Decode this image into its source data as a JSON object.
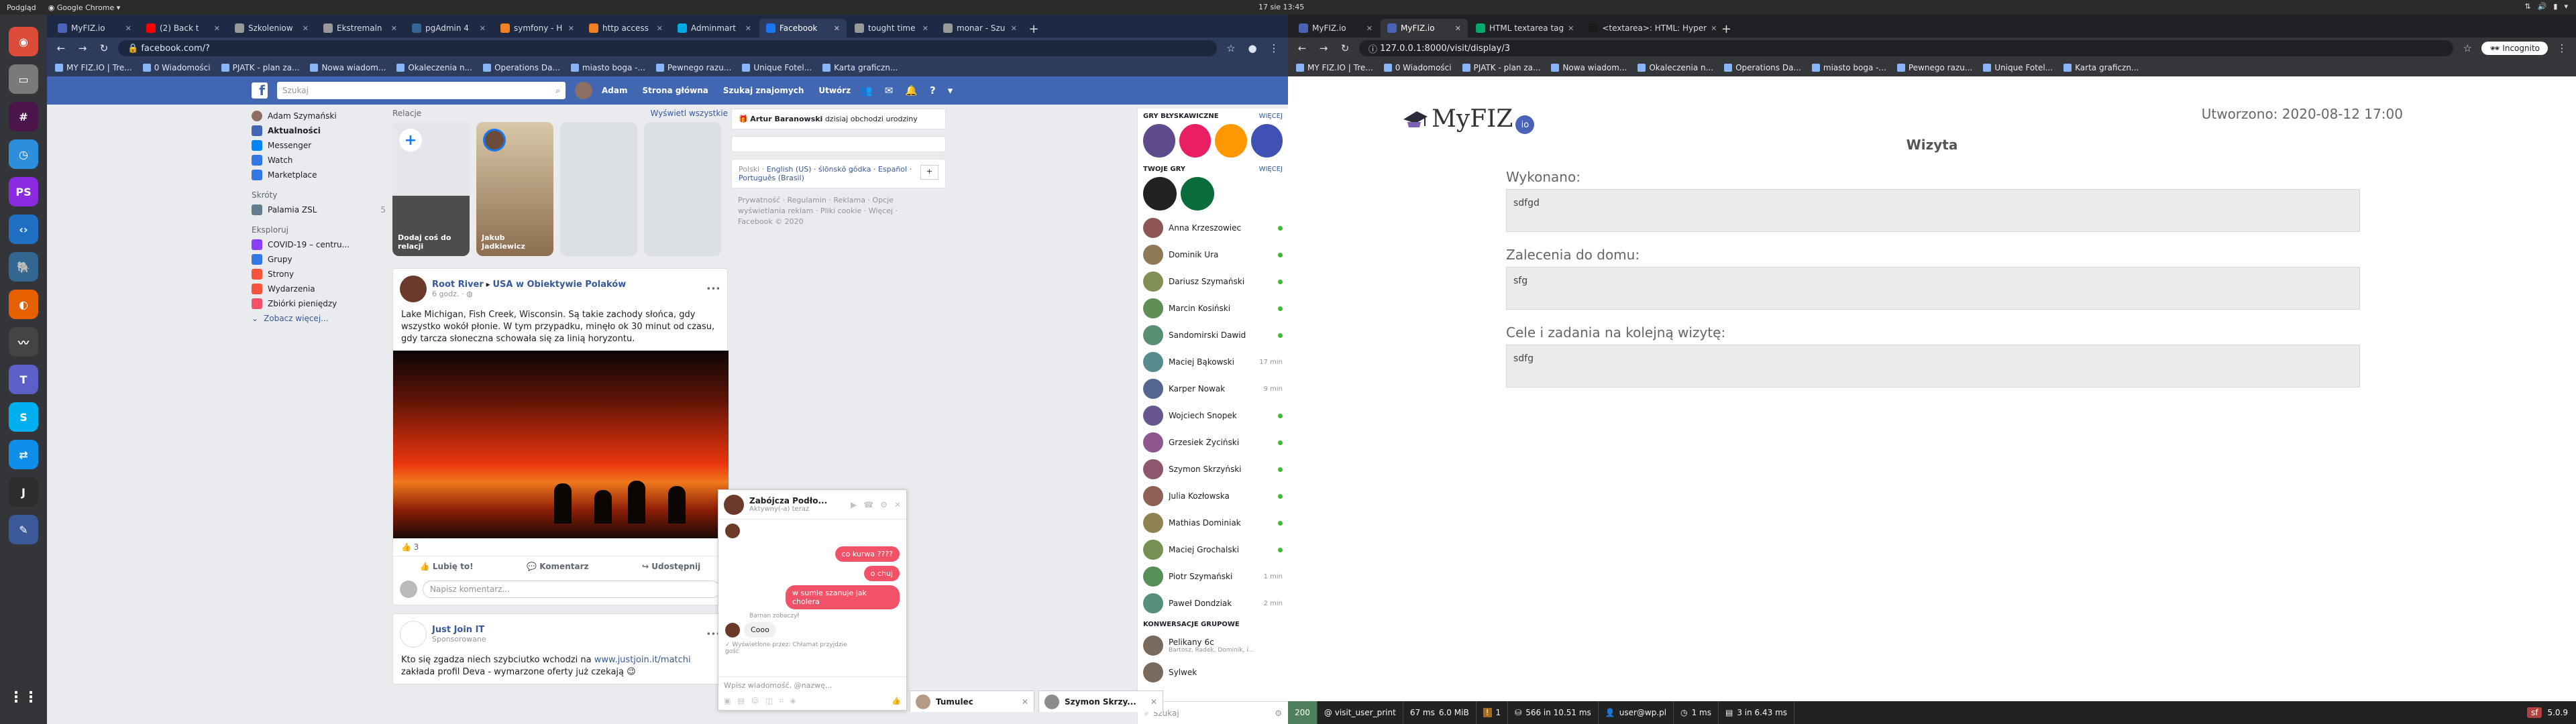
{
  "system": {
    "activity": "Podgląd",
    "app_menu": "Google Chrome",
    "clock": "17 sie  13:45"
  },
  "dock": {
    "items": [
      {
        "name": "chrome-icon",
        "color": "#dd4b39",
        "glyph": "◉"
      },
      {
        "name": "files-icon",
        "color": "#7a7a7a",
        "glyph": "▭"
      },
      {
        "name": "slack-icon",
        "color": "#4a154b",
        "glyph": "#"
      },
      {
        "name": "clock-icon",
        "color": "#2d8fdc",
        "glyph": "◷"
      },
      {
        "name": "phpstorm-icon",
        "color": "#8a2be2",
        "glyph": "PS"
      },
      {
        "name": "vscode-icon",
        "color": "#1f6fc5",
        "glyph": "‹›"
      },
      {
        "name": "pgadmin-icon",
        "color": "#336791",
        "glyph": "🐘"
      },
      {
        "name": "firefox-icon",
        "color": "#e66000",
        "glyph": "◐"
      },
      {
        "name": "monitor-icon",
        "color": "#444",
        "glyph": "〰"
      },
      {
        "name": "teams-icon",
        "color": "#5b5fc7",
        "glyph": "T"
      },
      {
        "name": "skype-icon",
        "color": "#00aff0",
        "glyph": "S"
      },
      {
        "name": "teamviewer-icon",
        "color": "#0e8ee9",
        "glyph": "⇄"
      },
      {
        "name": "jetbrains-icon",
        "color": "#2d2d2d",
        "glyph": "J"
      },
      {
        "name": "editor-icon",
        "color": "#3b5998",
        "glyph": "✎"
      }
    ]
  },
  "left_browser": {
    "tabs": [
      {
        "label": "MyFIZ.io",
        "color": "#4a63b8",
        "active": false
      },
      {
        "label": "(2) Back t",
        "color": "#ff0000",
        "active": false
      },
      {
        "label": "Szkoleniow",
        "color": "#999999",
        "active": false
      },
      {
        "label": "Ekstremaln",
        "color": "#999999",
        "active": false
      },
      {
        "label": "pgAdmin 4",
        "color": "#336791",
        "active": false
      },
      {
        "label": "symfony - H",
        "color": "#f48024",
        "active": false
      },
      {
        "label": "http access",
        "color": "#f48024",
        "active": false
      },
      {
        "label": "Adminmart",
        "color": "#00aae4",
        "active": false
      },
      {
        "label": "Facebook",
        "color": "#1877f2",
        "active": true
      },
      {
        "label": "tought time",
        "color": "#999999",
        "active": false
      },
      {
        "label": "monar - Szu",
        "color": "#999999",
        "active": false
      }
    ],
    "url": "facebook.com/?",
    "bookmarks": [
      "MY FIZ.IO | Tre...",
      "0 Wiadomości",
      "PJATK - plan za...",
      "Nowa wiadom...",
      "Okaleczenia n...",
      "Operations Da...",
      "miasto boga -...",
      "Pewnego razu...",
      "Unique Fotel...",
      "Karta graficzn..."
    ]
  },
  "facebook": {
    "search_placeholder": "Szukaj",
    "user": "Adam",
    "nav": [
      "Strona główna",
      "Szukaj znajomych",
      "Utwórz"
    ],
    "left": {
      "profile": "Adam Szymański",
      "items": [
        {
          "label": "Aktualności",
          "color": "#4267b2"
        },
        {
          "label": "Messenger",
          "color": "#0084ff"
        },
        {
          "label": "Watch",
          "color": "#3578e5"
        },
        {
          "label": "Marketplace",
          "color": "#3578e5"
        }
      ],
      "shortcuts_title": "Skróty",
      "shortcut": "Palamia ZSL",
      "shortcut_count": "5",
      "explore_title": "Eksploruj",
      "explore": [
        {
          "label": "COVID-19 – centru...",
          "color": "#8a3ffc"
        },
        {
          "label": "Grupy",
          "color": "#3578e5"
        },
        {
          "label": "Strony",
          "color": "#f5533d"
        },
        {
          "label": "Wydarzenia",
          "color": "#f5533d"
        },
        {
          "label": "Zbiórki pieniędzy",
          "color": "#f25268"
        }
      ],
      "see_more": "Zobacz więcej..."
    },
    "stories": {
      "title": "Relacje",
      "see_all": "Wyświetl wszystkie",
      "add_label": "Dodaj coś do relacji",
      "story_label": "Jakub Jadkiewicz"
    },
    "post": {
      "author": "Root River",
      "arrow": "▸",
      "target": "USA w Obiektywie Polaków",
      "time": "6 godz.",
      "text": "Lake Michigan, Fish Creek, Wisconsin. Są takie zachody słońca, gdy wszystko wokół płonie. W tym przypadku, minęło ok 30 minut od czasu, gdy tarcza słoneczna schowała się za linią horyzontu.",
      "likes": "3",
      "actions": [
        "Lubię to!",
        "Komentarz",
        "Udostępnij"
      ],
      "comment_placeholder": "Napisz komentarz..."
    },
    "post2": {
      "author": "Just Join IT",
      "meta": "Sponsorowane",
      "text": "Kto się zgadza niech szybciutko wchodzi na ",
      "link": "www.justjoin.it/matchi",
      "text2": "zakłada profil Deva - wymarzone oferty już czekają 😉"
    },
    "right": {
      "birthday_name": "Artur Baranowski",
      "birthday_text": " dzisiaj obchodzi urodziny",
      "lang_label": "Polski · ",
      "languages": "English (US) · ślōnskŏ gŏdka · Español · Português (Brasil)",
      "footer": "Prywatność · Regulamin · Reklama · Opcje wyświetlania reklam · Pliki cookie · Więcej ·",
      "copyright": "Facebook © 2020"
    },
    "chat": {
      "games_title": "GRY BŁYSKAWICZNE",
      "games_more": "WIĘCEJ",
      "your_games_title": "TWOJE GRY",
      "contacts": [
        {
          "name": "Anna Krzeszowiec",
          "time": ""
        },
        {
          "name": "Dominik Ura",
          "time": ""
        },
        {
          "name": "Dariusz Szymański",
          "time": ""
        },
        {
          "name": "Marcin Kosiński",
          "time": ""
        },
        {
          "name": "Sandomirski Dawid",
          "time": ""
        },
        {
          "name": "Maciej Bąkowski",
          "time": "17 min"
        },
        {
          "name": "Karper Nowak",
          "time": "9 min"
        },
        {
          "name": "Wojciech Snopek",
          "time": ""
        },
        {
          "name": "Grzesiek Życiński",
          "time": ""
        },
        {
          "name": "Szymon Skrzyński",
          "time": ""
        },
        {
          "name": "Julia Kozłowska",
          "time": ""
        },
        {
          "name": "Mathias Dominiak",
          "time": ""
        },
        {
          "name": "Maciej Grochalski",
          "time": ""
        },
        {
          "name": "Piotr Szymański",
          "time": "1 min"
        },
        {
          "name": "Paweł Dondziak",
          "time": "2 min"
        }
      ],
      "groups_title": "KONWERSACJE GRUPOWE",
      "groups": [
        {
          "name": "Pelikany 6c",
          "sub": "Bartosz, Radek, Dominik, i..."
        },
        {
          "name": "Sylwek",
          "sub": ""
        }
      ],
      "search_placeholder": "Szukaj"
    },
    "popup": {
      "name": "Zabójcza Podło...",
      "status": "Aktywny(-a) teraz",
      "messages": [
        "co kurwa ????",
        "o chuj",
        "w sumie szanuje jak cholera"
      ],
      "seen_by": "Barnan zobaczył",
      "incoming": "Cooo",
      "note": "✓ Wyświetlone przez: Chłamat przyjdzie",
      "note2": "gość",
      "input_placeholder": "Wpisz wiadomość, @nazwę..."
    },
    "tabs_bottom": [
      {
        "name": "Tumulec"
      },
      {
        "name": "Szymon Skrzy..."
      }
    ]
  },
  "right_browser": {
    "tabs": [
      {
        "label": "MyFIZ.io",
        "color": "#4a63b8",
        "active": false
      },
      {
        "label": "MyFIZ.io",
        "color": "#4a63b8",
        "active": true
      },
      {
        "label": "HTML textarea tag",
        "color": "#04aa6d",
        "active": false
      },
      {
        "label": "<textarea>: HTML: Hyper",
        "color": "#1b1b1b",
        "active": false
      }
    ],
    "url": "127.0.0.1:8000/visit/display/3",
    "incognito": "Incognito",
    "bookmarks": [
      "MY FIZ.IO | Tre...",
      "0 Wiadomości",
      "PJATK - plan za...",
      "Nowa wiadom...",
      "Okaleczenia n...",
      "Operations Da...",
      "miasto boga -...",
      "Pewnego razu...",
      "Unique Fotel...",
      "Karta graficzn..."
    ]
  },
  "myfiz": {
    "logo": "MyFIZ",
    "logo_badge": "io",
    "created": "Utworzono: 2020-08-12 17:00",
    "title": "Wizyta",
    "fields": [
      {
        "label": "Wykonano:",
        "value": "sdfgd"
      },
      {
        "label": "Zalecenia do domu:",
        "value": "sfg"
      },
      {
        "label": "Cele i zadania na kolejną wizytę:",
        "value": "sdfg"
      }
    ]
  },
  "profiler": {
    "status": "200",
    "route": "@ visit_user_print",
    "time": "67 ms",
    "memory": "6.0 MiB",
    "errors": "1",
    "db": "566 in 10.51 ms",
    "user": "user@wp.pl",
    "cache": "1 ms",
    "twig": "3 in 6.43 ms",
    "version": "5.0.9"
  }
}
